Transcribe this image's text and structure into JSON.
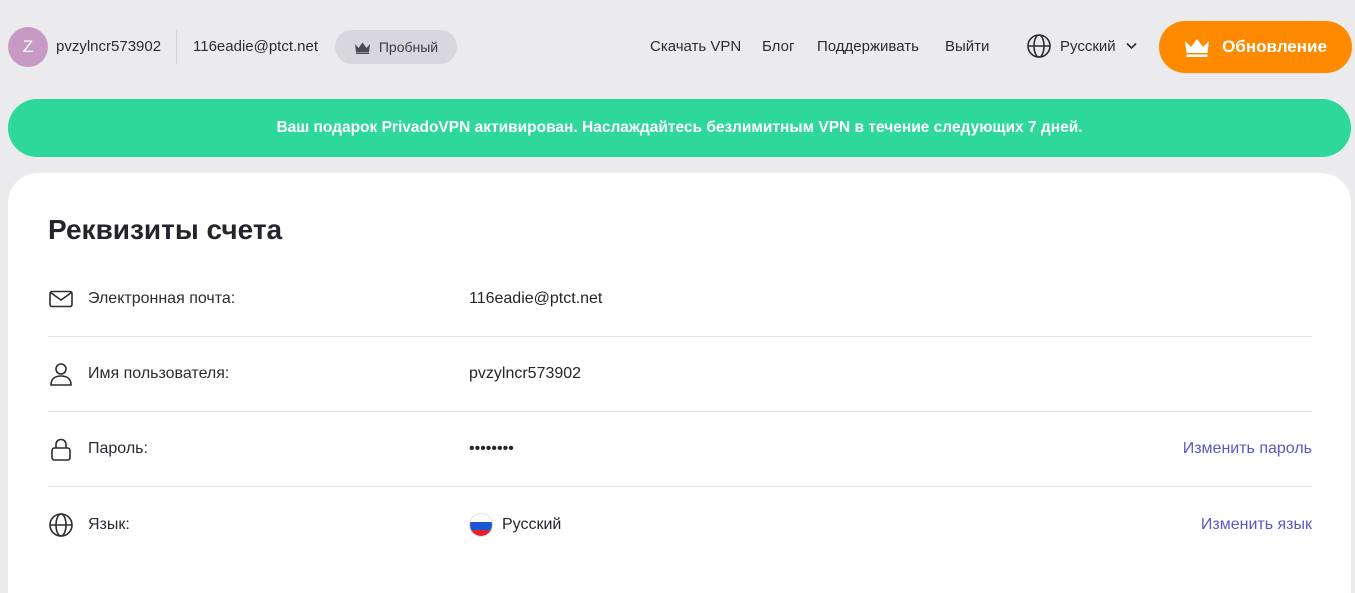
{
  "header": {
    "avatar_initial": "Z",
    "username": "pvzylncr573902",
    "email": "116eadie@ptct.net",
    "trial_badge": "Пробный",
    "nav": {
      "download": "Скачать VPN",
      "blog": "Блог",
      "support": "Поддерживать",
      "logout": "Выйти"
    },
    "language": "Русский",
    "upgrade_label": "Обновление"
  },
  "banner": {
    "text": "Ваш подарок PrivadoVPN активирован. Наслаждайтесь безлимитным VPN в течение следующих 7 дней."
  },
  "account": {
    "title": "Реквизиты счета",
    "rows": [
      {
        "label": "Электронная почта:",
        "value": "116eadie@ptct.net",
        "icon": "mail-icon"
      },
      {
        "label": "Имя пользователя:",
        "value": "pvzylncr573902",
        "icon": "user-icon"
      },
      {
        "label": "Пароль:",
        "value": "••••••••",
        "icon": "lock-icon",
        "action": "Изменить пароль"
      },
      {
        "label": "Язык:",
        "value": "Русский",
        "icon": "globe-icon",
        "action": "Изменить язык"
      }
    ]
  },
  "colors": {
    "accent_orange": "#ff8a00",
    "banner_green": "#2ed89b",
    "link_purple": "#5b57c9",
    "avatar_bg": "#c79ac6"
  }
}
